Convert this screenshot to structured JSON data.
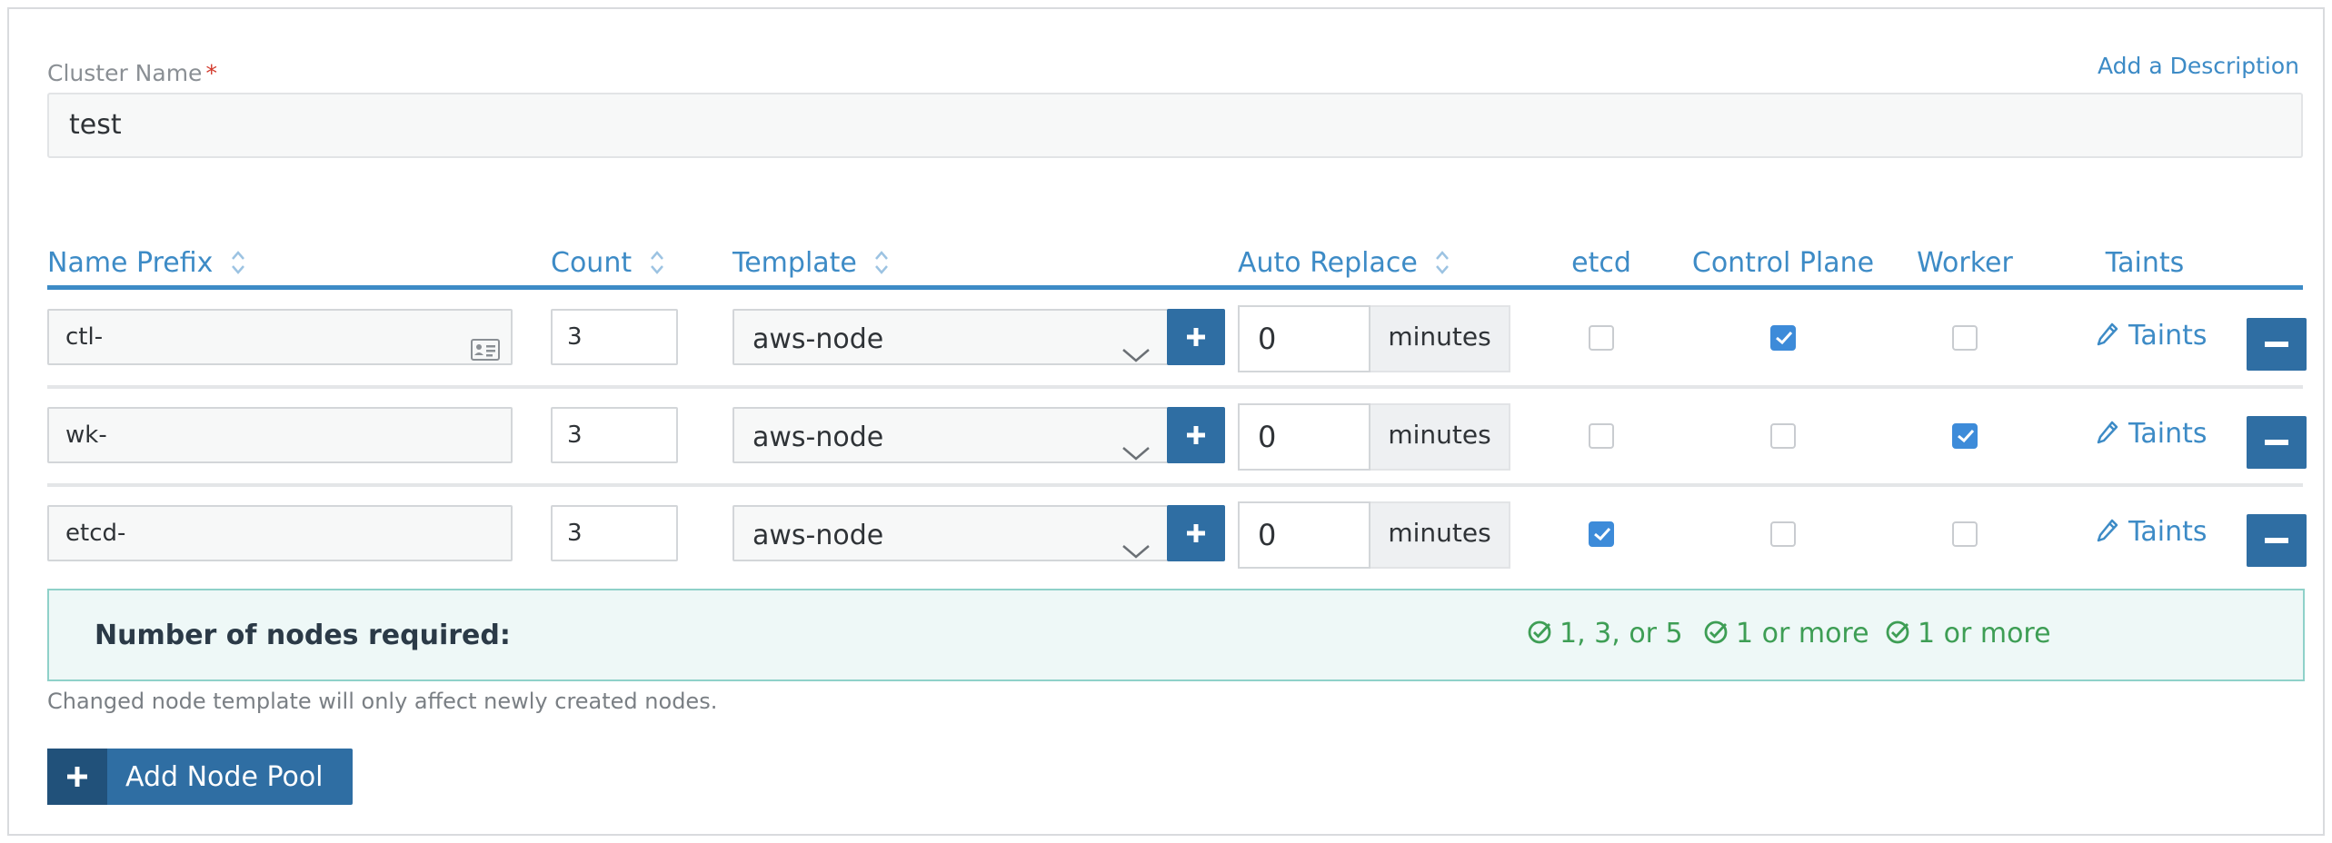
{
  "cluster": {
    "label": "Cluster Name",
    "required_mark": "*",
    "value": "test",
    "add_description": "Add a Description"
  },
  "table": {
    "headers": {
      "name_prefix": "Name Prefix",
      "count": "Count",
      "template": "Template",
      "auto_replace": "Auto Replace",
      "etcd": "etcd",
      "control_plane": "Control Plane",
      "worker": "Worker",
      "taints": "Taints"
    },
    "rows": [
      {
        "name_prefix": "ctl-",
        "count": "3",
        "template": "aws-node",
        "auto_replace": "0",
        "unit": "minutes",
        "etcd": false,
        "control_plane": true,
        "worker": false,
        "taints_label": "Taints"
      },
      {
        "name_prefix": "wk-",
        "count": "3",
        "template": "aws-node",
        "auto_replace": "0",
        "unit": "minutes",
        "etcd": false,
        "control_plane": false,
        "worker": true,
        "taints_label": "Taints"
      },
      {
        "name_prefix": "etcd-",
        "count": "3",
        "template": "aws-node",
        "auto_replace": "0",
        "unit": "minutes",
        "etcd": true,
        "control_plane": false,
        "worker": false,
        "taints_label": "Taints"
      }
    ]
  },
  "requirements": {
    "label": "Number of nodes required:",
    "etcd": "1, 3, or 5",
    "control_plane": "1 or more",
    "worker": "1 or more"
  },
  "note": "Changed node template will only affect newly created nodes.",
  "add_pool_label": "Add Node Pool",
  "colors": {
    "accent": "#3d8bc6",
    "button": "#2f6ea3",
    "success": "#3e9e55",
    "checkbox_on": "#3d8bd9"
  }
}
